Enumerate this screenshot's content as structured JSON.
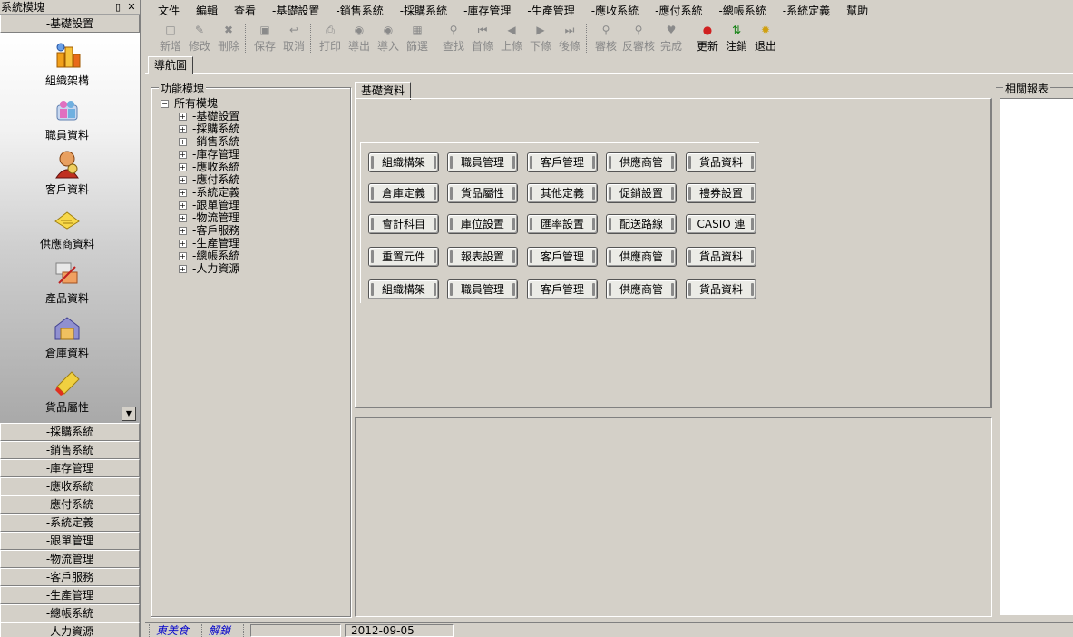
{
  "left_panel": {
    "title": "系統模塊",
    "pin_icon": "▯",
    "close_icon": "✕",
    "active_group": "-基礎設置",
    "items": [
      {
        "label": "組織架構",
        "icon": "org-structure-icon"
      },
      {
        "label": "職員資料",
        "icon": "staff-icon"
      },
      {
        "label": "客戶資料",
        "icon": "customer-icon"
      },
      {
        "label": "供應商資料",
        "icon": "supplier-icon"
      },
      {
        "label": "產品資料",
        "icon": "product-icon"
      },
      {
        "label": "倉庫資料",
        "icon": "warehouse-icon"
      },
      {
        "label": "貨品屬性",
        "icon": "goods-attr-icon"
      }
    ],
    "groups": [
      "-採購系統",
      "-銷售系統",
      "-庫存管理",
      "-應收系統",
      "-應付系統",
      "-系統定義",
      "-跟單管理",
      "-物流管理",
      "-客戶服務",
      "-生產管理",
      "-總帳系統",
      "-人力資源"
    ]
  },
  "menu": [
    "文件",
    "編輯",
    "查看",
    "-基礎設置",
    "-銷售系統",
    "-採購系統",
    "-庫存管理",
    "-生產管理",
    "-應收系統",
    "-應付系統",
    "-總帳系統",
    "-系統定義",
    "幫助"
  ],
  "toolbar": {
    "new": "新增",
    "edit": "修改",
    "delete": "刪除",
    "save": "保存",
    "cancel": "取消",
    "print": "打印",
    "export": "導出",
    "import": "導入",
    "filter": "篩選",
    "find": "查找",
    "first": "首條",
    "prev": "上條",
    "next": "下條",
    "last": "後條",
    "audit": "審核",
    "unaudit": "反審核",
    "complete": "完成",
    "refresh": "更新",
    "logout": "注銷",
    "exit": "退出"
  },
  "nav_tab": "導航圖",
  "function_tree": {
    "legend": "功能模塊",
    "root": "所有模塊",
    "children": [
      "-基礎設置",
      "-採購系統",
      "-銷售系統",
      "-庫存管理",
      "-應收系統",
      "-應付系統",
      "-系統定義",
      "-跟單管理",
      "-物流管理",
      "-客戶服務",
      "-生產管理",
      "-總帳系統",
      "-人力資源"
    ]
  },
  "base_tab": "基礎資料",
  "buttons": [
    [
      "組織構架",
      "職員管理",
      "客戶管理",
      "供應商管",
      "貨品資料"
    ],
    [
      "倉庫定義",
      "貨品屬性",
      "其他定義",
      "促銷設置",
      "禮券設置"
    ],
    [
      "會計科目",
      "庫位設置",
      "匯率設置",
      "配送路線",
      "CASIO 連"
    ],
    [
      "重置元件",
      "報表設置",
      "客戶管理",
      "供應商管",
      "貨品資料"
    ],
    [
      "組織構架",
      "職員管理",
      "客戶管理",
      "供應商管",
      "貨品資料"
    ]
  ],
  "report_legend": "相關報表",
  "status": {
    "user": "東美食",
    "unlock": "解鎖",
    "date": "2012-09-05"
  }
}
